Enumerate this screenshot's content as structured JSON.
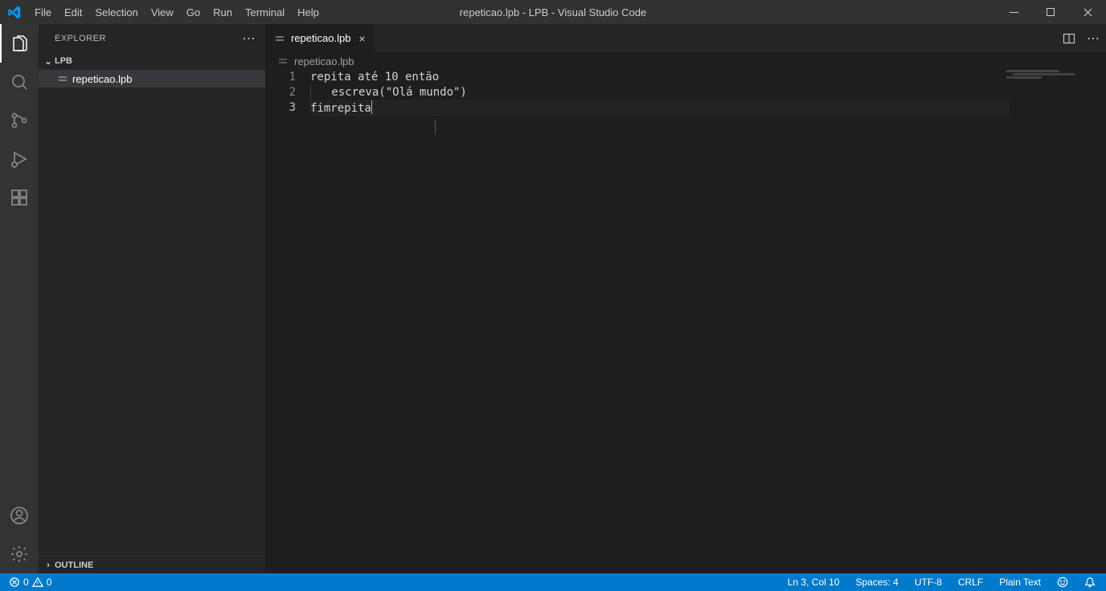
{
  "title": "repeticao.lpb - LPB - Visual Studio Code",
  "menu": {
    "file": "File",
    "edit": "Edit",
    "selection": "Selection",
    "view": "View",
    "go": "Go",
    "run": "Run",
    "terminal": "Terminal",
    "help": "Help"
  },
  "explorer": {
    "title": "EXPLORER",
    "folder": "LPB",
    "files": [
      {
        "name": "repeticao.lpb"
      }
    ],
    "outline": "OUTLINE"
  },
  "tab": {
    "name": "repeticao.lpb"
  },
  "breadcrumb": {
    "file": "repeticao.lpb"
  },
  "code": {
    "lines": [
      {
        "num": "1",
        "raw": "repita até 10 então"
      },
      {
        "num": "2",
        "raw": "    escreva(\"Olá mundo\")"
      },
      {
        "num": "3",
        "raw": "fimrepita"
      }
    ]
  },
  "status": {
    "errors": "0",
    "warnings": "0",
    "ln_col": "Ln 3, Col 10",
    "spaces": "Spaces: 4",
    "encoding": "UTF-8",
    "eol": "CRLF",
    "lang": "Plain Text"
  }
}
